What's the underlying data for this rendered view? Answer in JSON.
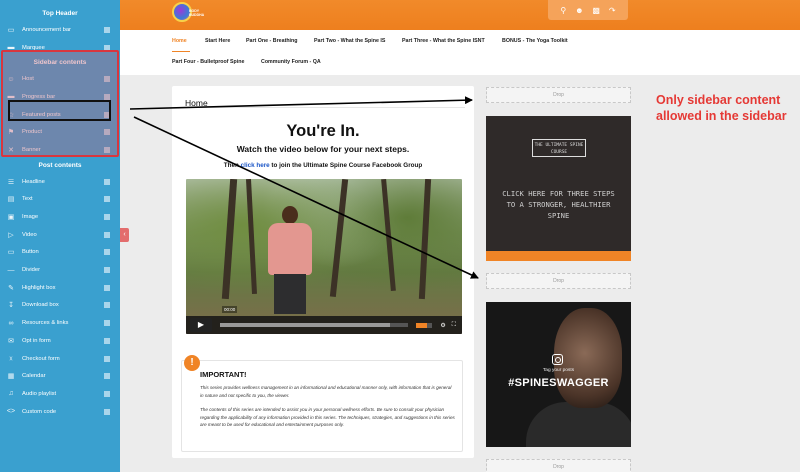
{
  "sidebar": {
    "sections": [
      {
        "heading": "Top Header",
        "items": [
          {
            "label": "Announcement bar",
            "icon": "megaphone-icon"
          },
          {
            "label": "Marquee",
            "icon": "marquee-icon"
          }
        ]
      },
      {
        "heading": "Sidebar contents",
        "items": [
          {
            "label": "Host",
            "icon": "user-icon"
          },
          {
            "label": "Progress bar",
            "icon": "progress-bar-icon"
          },
          {
            "label": "Featured posts",
            "icon": "star-icon"
          },
          {
            "label": "Product",
            "icon": "tag-icon"
          },
          {
            "label": "Banner",
            "icon": "banner-icon"
          }
        ]
      },
      {
        "heading": "Post contents",
        "items": [
          {
            "label": "Headline",
            "icon": "heading-icon"
          },
          {
            "label": "Text",
            "icon": "text-icon"
          },
          {
            "label": "Image",
            "icon": "image-icon"
          },
          {
            "label": "Video",
            "icon": "video-icon"
          },
          {
            "label": "Button",
            "icon": "button-icon"
          },
          {
            "label": "Divider",
            "icon": "divider-icon"
          },
          {
            "label": "Highlight box",
            "icon": "highlight-icon"
          },
          {
            "label": "Download box",
            "icon": "download-icon"
          },
          {
            "label": "Resources & links",
            "icon": "link-icon"
          },
          {
            "label": "Opt in form",
            "icon": "form-icon"
          },
          {
            "label": "Checkout form",
            "icon": "cart-icon"
          },
          {
            "label": "Calendar",
            "icon": "calendar-icon"
          },
          {
            "label": "Audio playlist",
            "icon": "audio-icon"
          },
          {
            "label": "Custom code",
            "icon": "code-icon"
          }
        ]
      }
    ]
  },
  "header": {
    "brand_color": "#f08426",
    "logo_text": "BODY BUDDHA",
    "icons": [
      "search-icon",
      "user-icon",
      "grid-icon",
      "logout-icon"
    ]
  },
  "nav": {
    "links": [
      "Home",
      "Start Here",
      "Part One - Breathing",
      "Part Two - What the Spine IS",
      "Part Three - What the Spine ISNT",
      "BONUS - The Yoga Toolkit",
      "Part Four - Bulletproof Spine",
      "Community Forum - QA"
    ],
    "active": "Home"
  },
  "main": {
    "breadcrumb": "Home",
    "headline": "You're In.",
    "subheadline": "Watch the video below for your next steps.",
    "fb_prefix": "Then ",
    "fb_link": "click here",
    "fb_suffix": " to join the Ultimate Spine Course Facebook Group",
    "video": {
      "time": "00:00",
      "progress_fraction": 0.0,
      "buffered_fraction": 0.9
    },
    "important": {
      "title": "IMPORTANT!",
      "para1": "This series provides wellness management in an informational and educational manner only, with information that is general in nature and not specific to you, the viewer.",
      "para2": "The contents of this series are intended to assist you in your personal wellness efforts. Be sure to consult your physician regarding the applicability of any information provided in this series. The techniques, strategies, and suggestions in this series are meant to be used for educational and entertainment purposes only."
    }
  },
  "right_column": {
    "drop_label": "Drop",
    "promo1": {
      "badge": "THE ULTIMATE SPINE COURSE",
      "text": "CLICK HERE FOR THREE STEPS TO A STRONGER, HEALTHIER SPINE"
    },
    "promo2": {
      "tag": "Tag your posts",
      "hashtag": "#SPINESWAGGER"
    }
  },
  "annotation": {
    "text": "Only sidebar content allowed in the sidebar",
    "color": "#e53935"
  }
}
